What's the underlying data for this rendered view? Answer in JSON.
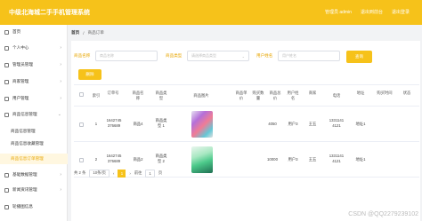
{
  "header": {
    "title": "中级北海城二手手机管理系统",
    "links": [
      "管理员 admin",
      "退出到前台",
      "退出登录"
    ]
  },
  "sidebar": {
    "items": [
      {
        "label": "首页",
        "chev": ""
      },
      {
        "label": "个人中心",
        "chev": "›"
      },
      {
        "label": "管理员管理",
        "chev": "›"
      },
      {
        "label": "商家管理",
        "chev": "›"
      },
      {
        "label": "用户管理",
        "chev": "›"
      },
      {
        "label": "商品信息管理",
        "chev": "⌄"
      },
      {
        "label": "商品信息管理",
        "chev": ""
      },
      {
        "label": "商品信息收藏管理",
        "chev": ""
      },
      {
        "label": "商品信息订单管理",
        "chev": ""
      },
      {
        "label": "基础数据管理",
        "chev": "›"
      },
      {
        "label": "新闻资讯管理",
        "chev": "›"
      },
      {
        "label": "轮播图信息",
        "chev": ""
      }
    ]
  },
  "breadcrumb": [
    "首页",
    "/",
    "商品订单"
  ],
  "filters": {
    "labels": [
      "商品名称",
      "商品类型",
      "用户姓名"
    ],
    "placeholders": [
      "商品名称",
      "请选择商品类型",
      "用户姓名"
    ],
    "search_label": "查询",
    "delete_label": "删除"
  },
  "table": {
    "columns": [
      "索引",
      "订单号",
      "商品名称",
      "商品类型",
      "商品图片",
      "商品单价",
      "购买数量",
      "商品总价",
      "用户姓名",
      "商家",
      "电话",
      "地址",
      "购买时间",
      "状态"
    ],
    "rows": [
      {
        "index": "1",
        "order_no": "1642745 376689",
        "name": "商品4",
        "type": "商品类型 1",
        "price": "",
        "qty": "",
        "total": "4050",
        "user": "用户3",
        "shop": "王五",
        "phone": "1331141 4121",
        "addr": "地址1",
        "time": "",
        "status": ""
      },
      {
        "index": "2",
        "order_no": "1642745 376689",
        "name": "商品2",
        "type": "商品类型 2",
        "price": "",
        "qty": "",
        "total": "10000",
        "user": "用户3",
        "shop": "王五",
        "phone": "1331141 4121",
        "addr": "地址1",
        "time": "",
        "status": ""
      }
    ]
  },
  "pager": {
    "total": "共 2 条",
    "page_size": "10条/页",
    "prev": "‹",
    "page": "1",
    "next": "›",
    "goto_label": "前往",
    "goto_value": "1",
    "page_suffix": "页"
  },
  "watermark": "CSDN @QQ2279239102",
  "colors": {
    "accent": "#f6c21a",
    "accent_text": "#e8a600"
  }
}
